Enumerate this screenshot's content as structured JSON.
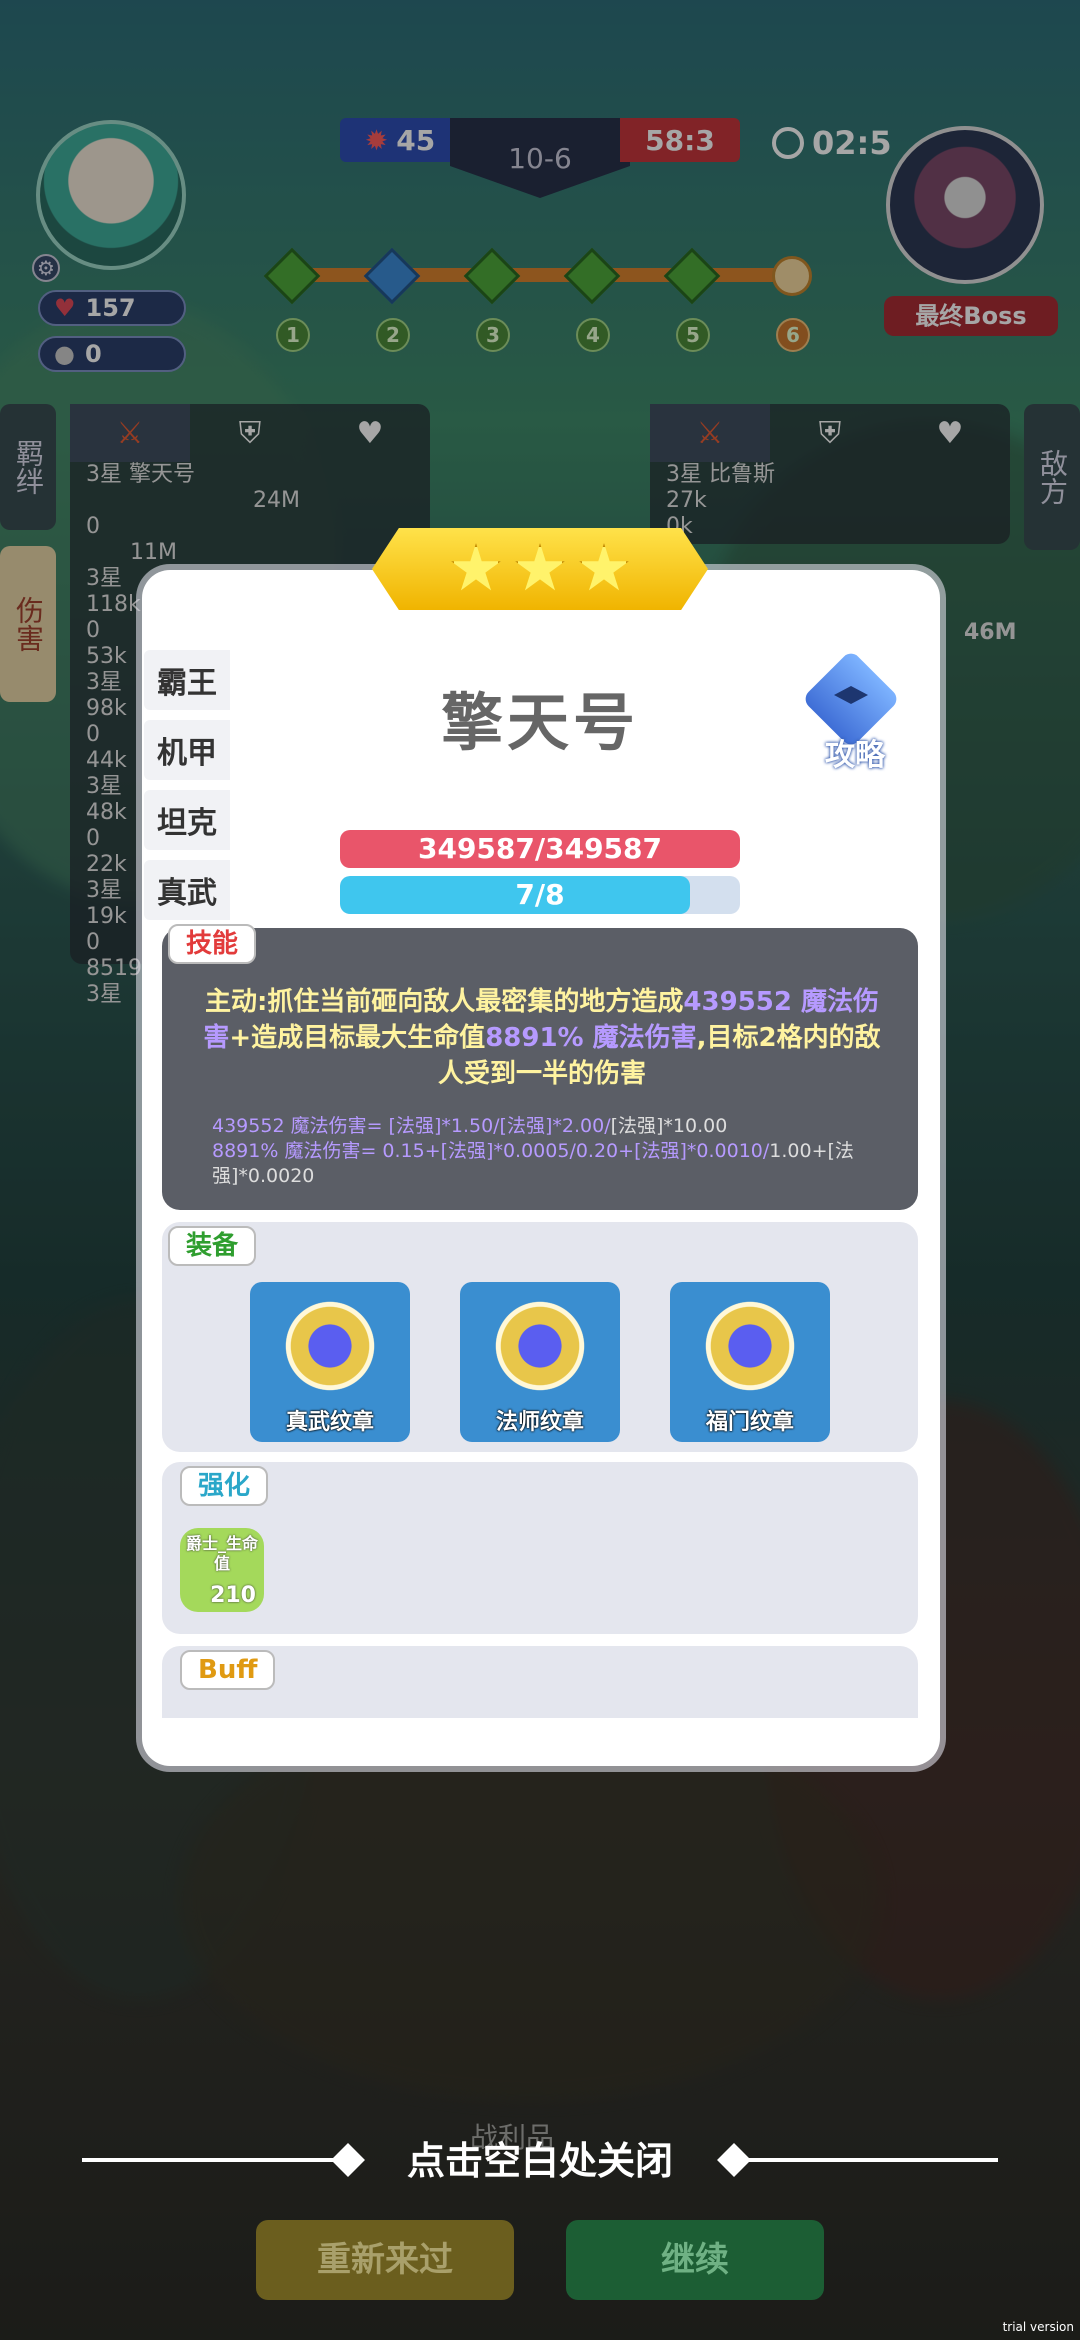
{
  "hud": {
    "player_hp": "157",
    "player_gold": "0",
    "score_left": "45",
    "stage": "10-6",
    "score_right": "58:3",
    "timer": "02:5",
    "boss_label": "最终Boss",
    "stage_numbers": [
      "1",
      "2",
      "3",
      "4",
      "5",
      "6"
    ]
  },
  "side_tabs": {
    "left_top": "羁绊",
    "left_bottom": "伤害",
    "right": "敌方"
  },
  "team_left": {
    "rows": [
      "3星 擎天号",
      "24M",
      "0",
      "11M",
      "3星",
      "118k",
      "0",
      "53k",
      "3星",
      "98k",
      "0",
      "44k",
      "3星",
      "48k",
      "0",
      "22k",
      "3星",
      "19k",
      "0",
      "8519",
      "3星"
    ]
  },
  "team_right": {
    "rows": [
      "3星 比鲁斯",
      "27k",
      "0k",
      "46M"
    ]
  },
  "modal": {
    "unit_name": "擎天号",
    "guide_label": "攻略",
    "traits": [
      "霸王",
      "机甲",
      "坦克",
      "真武"
    ],
    "hp_text": "349587/349587",
    "mana_text": "7/8",
    "mana_ratio": 0.875,
    "skill": {
      "tag": "技能",
      "text_a": "主动:抓住当前砸向敌人最密集的地方造成",
      "value_a": "439552 魔法伤害",
      "text_b": "+造成目标最大生命值",
      "value_b": "8891% 魔法伤害",
      "text_c": ",目标2格内的敌人受到一半的伤害",
      "formula_1_prefix": "439552 魔法伤害= [法强]*1.50/[法强]*2.00/",
      "formula_1_suffix": "[法强]*10.00",
      "formula_2_prefix": "8891% 魔法伤害= 0.15+[法强]*0.0005/0.20+[法强]*0.0010/",
      "formula_2_suffix": "1.00+[法强]*0.0020"
    },
    "equipment": {
      "tag": "装备",
      "items": [
        "真武纹章",
        "法师纹章",
        "福门纹章"
      ]
    },
    "enhance": {
      "tag": "强化",
      "item_title": "爵士_生命值",
      "item_value": "210"
    },
    "buff": {
      "tag": "Buff"
    }
  },
  "bottom": {
    "behind_label": "战利品",
    "close_hint": "点击空白处关闭",
    "retry_label": "重新来过",
    "continue_label": "继续"
  },
  "watermark": "trial version",
  "colors": {
    "hp_red": "#e9556a",
    "mana_blue": "#3fc6ee",
    "skill_yellow": "#fff3a0",
    "skill_purple": "#b69aff"
  }
}
